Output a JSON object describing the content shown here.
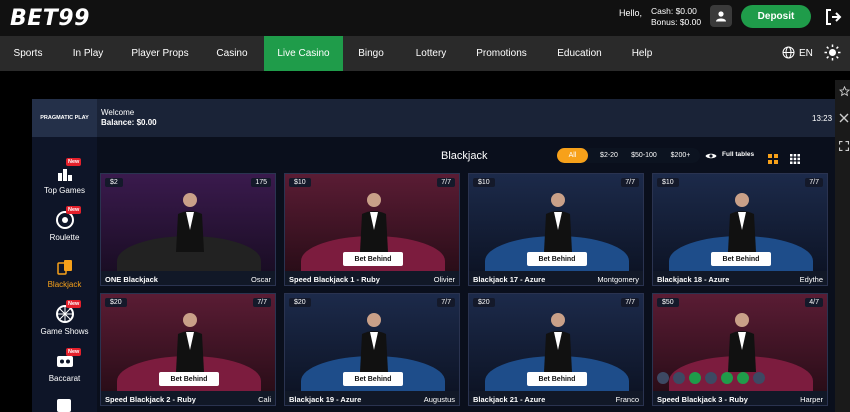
{
  "header": {
    "logo": "BET99",
    "hello": "Hello,",
    "cash": "Cash: $0.00",
    "bonus": "Bonus: $0.00",
    "deposit": "Deposit"
  },
  "nav": {
    "items": [
      "Sports",
      "In Play",
      "Player Props",
      "Casino",
      "Live Casino",
      "Bingo",
      "Lottery",
      "Promotions",
      "Education",
      "Help"
    ],
    "active": "Live Casino",
    "lang": "EN"
  },
  "game": {
    "provider": "PRAGMATIC PLAY",
    "welcome": "Welcome",
    "balance": "Balance: $0.00",
    "clock": "13:23",
    "title": "Blackjack",
    "filters": [
      "All",
      "$2-20",
      "$50-100",
      "$200+"
    ],
    "full_tables": "Full tables",
    "new_badge": "New"
  },
  "sidebar": [
    {
      "label": "Top Games",
      "icon": "top-games-icon",
      "new": true
    },
    {
      "label": "Roulette",
      "icon": "roulette-icon",
      "new": true
    },
    {
      "label": "Blackjack",
      "icon": "blackjack-icon",
      "new": false,
      "active": true
    },
    {
      "label": "Game Shows",
      "icon": "game-shows-icon",
      "new": true
    },
    {
      "label": "Baccarat",
      "icon": "baccarat-icon",
      "new": true
    }
  ],
  "tables": [
    {
      "name": "ONE Blackjack",
      "dealer": "Oscar",
      "bet": "$2",
      "seats": "175",
      "style": "purple",
      "bet_behind": ""
    },
    {
      "name": "Speed Blackjack 1 - Ruby",
      "dealer": "Olivier",
      "bet": "$10",
      "seats": "7/7",
      "style": "ruby",
      "bet_behind": "Bet Behind"
    },
    {
      "name": "Blackjack 17 - Azure",
      "dealer": "Montgomery",
      "bet": "$10",
      "seats": "7/7",
      "style": "azure",
      "bet_behind": "Bet Behind"
    },
    {
      "name": "Blackjack 18 - Azure",
      "dealer": "Edythe",
      "bet": "$10",
      "seats": "7/7",
      "style": "azure",
      "bet_behind": "Bet Behind"
    },
    {
      "name": "Speed Blackjack 2 - Ruby",
      "dealer": "Cali",
      "bet": "$20",
      "seats": "7/7",
      "style": "ruby",
      "bet_behind": "Bet Behind"
    },
    {
      "name": "Blackjack 19 - Azure",
      "dealer": "Augustus",
      "bet": "$20",
      "seats": "7/7",
      "style": "azure",
      "bet_behind": "Bet Behind"
    },
    {
      "name": "Blackjack 21 - Azure",
      "dealer": "Franco",
      "bet": "$20",
      "seats": "7/7",
      "style": "azure",
      "bet_behind": "Bet Behind"
    },
    {
      "name": "Speed Blackjack 3 - Ruby",
      "dealer": "Harper",
      "bet": "$50",
      "seats": "4/7",
      "style": "ruby",
      "bet_behind": ""
    }
  ],
  "colors": {
    "accent": "#1f9c4a",
    "filter_active": "#f7a11a",
    "new_badge": "#e4202b"
  }
}
